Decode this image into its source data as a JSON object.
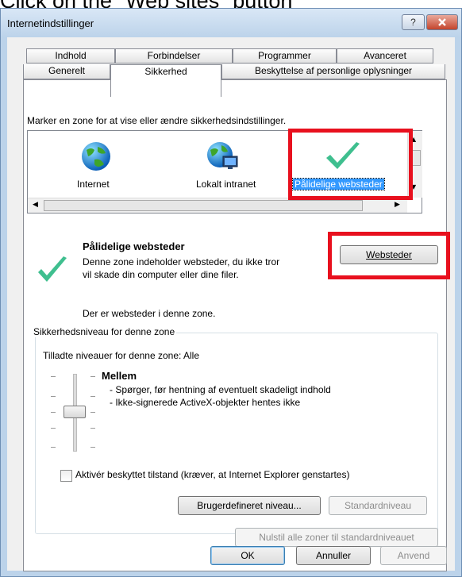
{
  "caption": "Click on the \"Web sites\" button",
  "window": {
    "title": "Internetindstillinger",
    "help_label": "?",
    "close_label": "x"
  },
  "tabs_row1": [
    {
      "label": "Indhold"
    },
    {
      "label": "Forbindelser"
    },
    {
      "label": "Programmer"
    },
    {
      "label": "Avanceret"
    }
  ],
  "tabs_row2": [
    {
      "label": "Generelt"
    },
    {
      "label": "Sikkerhed"
    },
    {
      "label": "Beskyttelse af personlige oplysninger"
    }
  ],
  "security": {
    "instruction": "Marker en zone for at vise eller ændre sikkerhedsindstillinger.",
    "zones": [
      {
        "label": "Internet",
        "icon": "globe-icon"
      },
      {
        "label": "Lokalt intranet",
        "icon": "intranet-icon"
      },
      {
        "label": "Pålidelige websteder",
        "icon": "checkmark-icon",
        "selected": true
      }
    ],
    "zone_title": "Pålidelige websteder",
    "zone_desc_line1": "Denne zone indeholder websteder, du ikke tror",
    "zone_desc_line2": "vil skade din computer eller dine filer.",
    "sites_button": "Websteder",
    "sites_info": "Der er websteder i denne zone.",
    "level_group_label": "Sikkerhedsniveau for denne zone",
    "allowed_levels": "Tilladte niveauer for denne zone: Alle",
    "level_name": "Mellem",
    "level_bullet1": "- Spørger, før hentning af eventuelt skadeligt indhold",
    "level_bullet2": "- Ikke-signerede ActiveX-objekter hentes ikke",
    "protected_mode_label": "Aktivér beskyttet tilstand (kræver, at Internet Explorer genstartes)",
    "protected_mode_checked": false,
    "custom_level_button": "Brugerdefineret niveau...",
    "default_level_button": "Standardniveau",
    "reset_all_button": "Nulstil alle zoner til standardniveauet"
  },
  "footer": {
    "ok": "OK",
    "cancel": "Annuller",
    "apply": "Anvend"
  },
  "colors": {
    "highlight_box": "#e8101e",
    "selection": "#3399ff"
  }
}
